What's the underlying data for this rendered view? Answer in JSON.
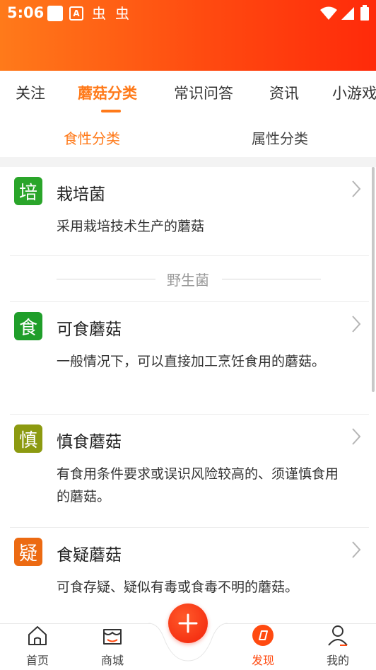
{
  "status_bar": {
    "time": "5:06",
    "a_label": "A",
    "bug_glyph": "虫"
  },
  "tabs": [
    {
      "label": "关注"
    },
    {
      "label": "蘑菇分类"
    },
    {
      "label": "常识问答"
    },
    {
      "label": "资讯"
    },
    {
      "label": "小游戏"
    }
  ],
  "subtabs": [
    {
      "label": "食性分类"
    },
    {
      "label": "属性分类"
    }
  ],
  "cultivated": {
    "badge": "培",
    "badge_color": "#2aa52a",
    "title": "栽培菌",
    "desc": "采用栽培技术生产的蘑菇"
  },
  "divider_label": "野生菌",
  "wild": [
    {
      "badge": "食",
      "badge_color": "#1f9e2a",
      "title": "可食蘑菇",
      "desc": "一般情况下，可以直接加工烹饪食用的蘑菇。"
    },
    {
      "badge": "慎",
      "badge_color": "#8c9a10",
      "title": "慎食蘑菇",
      "desc": "有食用条件要求或误识风险较高的、须谨慎食用的蘑菇。"
    },
    {
      "badge": "疑",
      "badge_color": "#ec6a12",
      "title": "食疑蘑菇",
      "desc": "可食存疑、疑似有毒或食毒不明的蘑菇。"
    }
  ],
  "bottom_nav": [
    {
      "label": "首页",
      "icon": "home-icon"
    },
    {
      "label": "商城",
      "icon": "shop-icon"
    },
    {
      "label": "发现",
      "icon": "discover-icon"
    },
    {
      "label": "我的",
      "icon": "profile-icon"
    }
  ],
  "colors": {
    "accent": "#ff7a1a",
    "header_end": "#ff2a0a",
    "fab": "#f2220a"
  }
}
